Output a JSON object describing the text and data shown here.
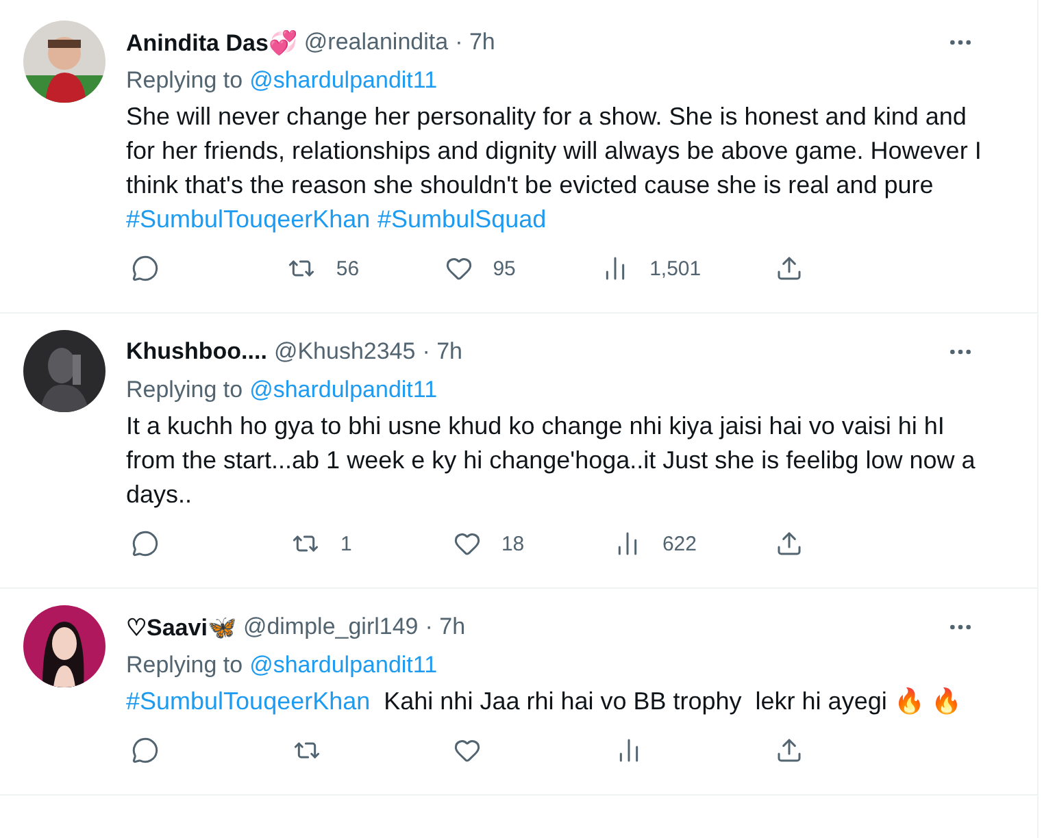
{
  "tweets": [
    {
      "name": "Anindita Das💞",
      "handle": "@realanindita",
      "time": "· 7h",
      "replying_label": "Replying to",
      "mention": "@shardulpandit11",
      "body": [
        {
          "kind": "text",
          "text": "She will never change her personality for a show. She is honest and kind and for her friends, relationships and dignity will always be above game. However I think that's the reason she shouldn't be evicted cause she is real and pure\n"
        },
        {
          "kind": "hashtag",
          "text": "#SumbulTouqeerKhan"
        },
        {
          "kind": "hashtag",
          "text": "#SumbulSquad"
        }
      ],
      "actions": [
        {
          "kind": "reply"
        },
        {
          "kind": "retweet",
          "count": "56"
        },
        {
          "kind": "like",
          "count": "95"
        },
        {
          "kind": "views",
          "count": "1,501"
        },
        {
          "kind": "share"
        }
      ]
    },
    {
      "name": "Khushboo....",
      "handle": "@Khush2345",
      "time": "· 7h",
      "replying_label": "Replying to",
      "mention": "@shardulpandit11",
      "body": [
        {
          "kind": "text",
          "text": "It a kuchh ho gya to bhi usne khud ko change nhi kiya jaisi hai vo vaisi hi hI from the start...ab 1 week e ky hi change'hoga..it Just she is feelibg low now a days.."
        }
      ],
      "actions": [
        {
          "kind": "reply"
        },
        {
          "kind": "retweet",
          "count": "1"
        },
        {
          "kind": "like",
          "count": "18"
        },
        {
          "kind": "views",
          "count": "622"
        },
        {
          "kind": "share"
        }
      ]
    },
    {
      "name": "♡Saavi🦋",
      "handle": "@dimple_girl149",
      "time": "· 7h",
      "replying_label": "Replying to",
      "mention": "@shardulpandit11",
      "body": [
        {
          "kind": "hashtag",
          "text": "#SumbulTouqeerKhan"
        },
        {
          "kind": "text",
          "text": "  Kahi nhi Jaa rhi hai vo BB trophy  lekr hi ayegi 🔥 🔥"
        }
      ],
      "actions": [
        {
          "kind": "reply"
        },
        {
          "kind": "retweet"
        },
        {
          "kind": "like"
        },
        {
          "kind": "views"
        },
        {
          "kind": "share"
        }
      ]
    }
  ]
}
